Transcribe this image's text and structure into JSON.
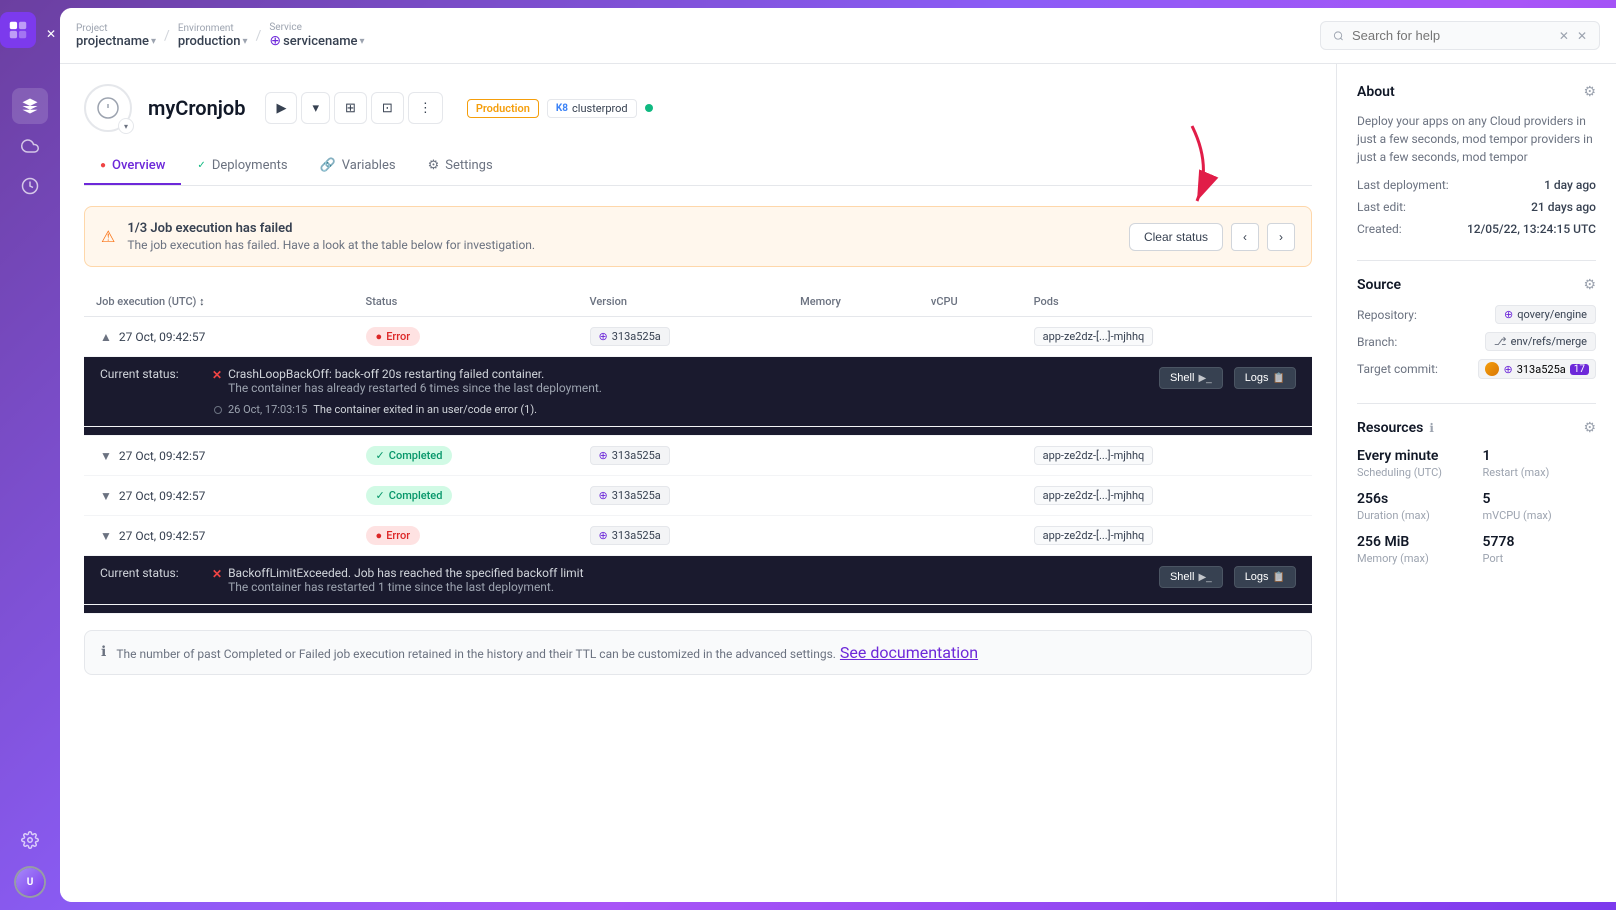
{
  "app": {
    "title": "myCronjob"
  },
  "header": {
    "project_label": "Project",
    "project_value": "projectname",
    "environment_label": "Environment",
    "environment_value": "production",
    "service_label": "Service",
    "service_value": "servicename",
    "search_placeholder": "Search for help"
  },
  "tabs": [
    {
      "id": "overview",
      "label": "Overview",
      "active": true
    },
    {
      "id": "deployments",
      "label": "Deployments",
      "active": false
    },
    {
      "id": "variables",
      "label": "Variables",
      "active": false
    },
    {
      "id": "settings",
      "label": "Settings",
      "active": false
    }
  ],
  "alert": {
    "count": "1/3",
    "title": "Job execution has failed",
    "description": "The job execution has failed. Have a look at the table below for investigation.",
    "clear_label": "Clear status"
  },
  "table": {
    "columns": [
      "Job execution (UTC)",
      "Status",
      "Version",
      "Memory",
      "vCPU",
      "Pods"
    ],
    "rows": [
      {
        "id": "row1",
        "date": "27 Oct, 09:42:57",
        "status": "Error",
        "status_type": "error",
        "version": "313a525a",
        "pod": "app-ze2dz-[...]-mjhhq",
        "expanded": true,
        "current_status_label": "Current status:",
        "error_text": "CrashLoopBackOff: back-off 20s restarting failed container.",
        "error_detail": "The container has already restarted 6 times since the last deployment.",
        "log_entry_date": "26 Oct, 17:03:15",
        "log_entry_text": "The container exited in an user/code error (1).",
        "has_shell": true,
        "has_logs": true
      },
      {
        "id": "row2",
        "date": "27 Oct, 09:42:57",
        "status": "Completed",
        "status_type": "completed",
        "version": "313a525a",
        "pod": "app-ze2dz-[...]-mjhhq",
        "expanded": false
      },
      {
        "id": "row3",
        "date": "27 Oct, 09:42:57",
        "status": "Completed",
        "status_type": "completed",
        "version": "313a525a",
        "pod": "app-ze2dz-[...]-mjhhq",
        "expanded": false
      },
      {
        "id": "row4",
        "date": "27 Oct, 09:42:57",
        "status": "Error",
        "status_type": "error",
        "version": "313a525a",
        "pod": "app-ze2dz-[...]-mjhhq",
        "expanded": true,
        "current_status_label": "Current status:",
        "error_text": "BackoffLimitExceeded. Job has reached the specified backoff limit",
        "error_detail": "The container has restarted 1 time since the last deployment.",
        "has_shell": true,
        "has_logs": true
      }
    ]
  },
  "info_footer": {
    "text": "The number of past Completed or Failed job execution retained in the history and their TTL can be customized in the advanced settings.",
    "link_text": "See documentation"
  },
  "about": {
    "title": "About",
    "description": "Deploy your apps on any Cloud providers in just a few seconds, mod tempor providers in just a few seconds, mod tempor",
    "last_deployment_label": "Last deployment:",
    "last_deployment_value": "1 day ago",
    "last_edit_label": "Last edit:",
    "last_edit_value": "21 days ago",
    "created_label": "Created:",
    "created_value": "12/05/22, 13:24:15 UTC"
  },
  "source": {
    "title": "Source",
    "repository_label": "Repository:",
    "repository_value": "qovery/engine",
    "branch_label": "Branch:",
    "branch_value": "env/refs/merge",
    "target_commit_label": "Target commit:",
    "target_commit_value": "313a525a",
    "commit_count": "17"
  },
  "resources": {
    "title": "Resources",
    "scheduling_label": "Every minute",
    "scheduling_value": "1",
    "scheduling_sub": "Scheduling (UTC)",
    "scheduling_sub_value": "Restart (max)",
    "duration_value": "256s",
    "duration_label": "Duration (max)",
    "vcpu_value": "5",
    "vcpu_label": "mVCPU (max)",
    "memory_value": "256 MiB",
    "memory_label": "Memory (max)",
    "port_value": "5778",
    "port_label": "Port"
  },
  "buttons": {
    "shell": "Shell",
    "logs": "Logs",
    "play": "▶",
    "expand_deploy": "⊞"
  }
}
